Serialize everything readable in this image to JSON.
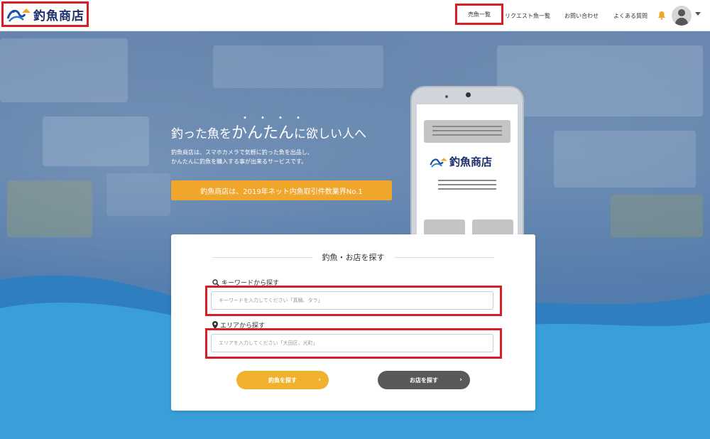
{
  "header": {
    "logo_text": "釣魚商店",
    "nav": [
      {
        "label": "売魚一覧",
        "active": true
      },
      {
        "label": "リクエスト魚一覧",
        "active": false
      },
      {
        "label": "お問い合わせ",
        "active": false
      },
      {
        "label": "よくある質問",
        "active": false
      }
    ]
  },
  "hero": {
    "dots": "・・・・",
    "title_pre": "釣った魚を",
    "title_big": "かんたん",
    "title_post": "に欲しい人へ",
    "desc_line1": "釣魚商店は、スマホカメラで気軽に釣った魚を出品し、",
    "desc_line2": "かんたんに釣魚を購入する事が出来るサービスです。",
    "badge": "釣魚商店は、2019年ネット内魚取引件数業界No.1",
    "phone_logo": "釣魚商店"
  },
  "search": {
    "title": "釣魚・お店を探す",
    "keyword_label": "キーワードから探す",
    "keyword_placeholder": "キーワードを入力してください「真鯛、タラ」",
    "area_label": "エリアから探す",
    "area_placeholder": "エリアを入力してください「大田区、光町」",
    "fish_button": "釣魚を探す",
    "shop_button": "お店を探す",
    "arrow": "›"
  },
  "colors": {
    "accent_red": "#d81e25",
    "orange": "#f0a52b",
    "navy": "#1b2f6b"
  }
}
